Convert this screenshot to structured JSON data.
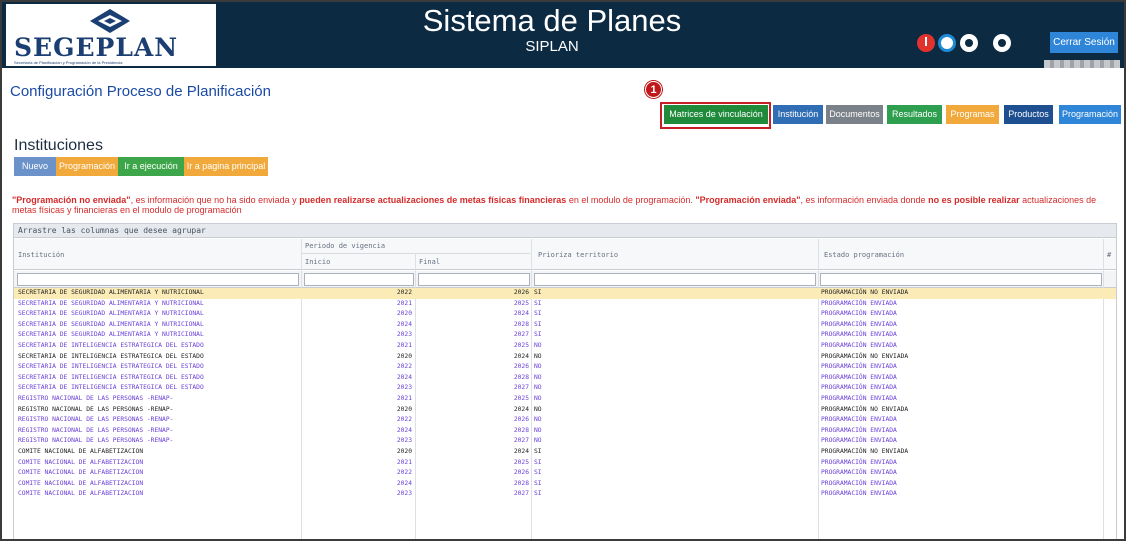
{
  "header": {
    "logo_text": "SEGEPLAN",
    "logo_subtitle": "Secretaría de Planificación y Programación de la Presidencia",
    "app_title": "Sistema de Planes",
    "app_subtitle": "SIPLAN",
    "logout_label": "Cerrar Sesión",
    "icons": [
      "alert-icon",
      "disk-icon",
      "circle-icon",
      "circle-icon"
    ]
  },
  "page": {
    "config_title": "Configuración Proceso de Planificación",
    "step_badge": "1"
  },
  "top_nav": [
    {
      "label": "Matrices de vinculación",
      "color": "#1e8a3a"
    },
    {
      "label": "Institución",
      "color": "#2f6db5"
    },
    {
      "label": "Documentos",
      "color": "#7a8189"
    },
    {
      "label": "Resultados",
      "color": "#2e9e4f"
    },
    {
      "label": "Programas",
      "color": "#f2a93b"
    },
    {
      "label": "Productos",
      "color": "#1d4f91"
    },
    {
      "label": "Programación",
      "color": "#2f86d9"
    }
  ],
  "institutions": {
    "title": "Instituciones",
    "actions": [
      {
        "label": "Nuevo",
        "color": "#6c93c9"
      },
      {
        "label": "Programación",
        "color": "#f2a93b"
      },
      {
        "label": "Ir a ejecución",
        "color": "#3ea64a"
      },
      {
        "label": "Ir a pagina principal",
        "color": "#f2a93b"
      }
    ]
  },
  "notice": {
    "p1_bold": "\"Programación no enviada\"",
    "p2": ", es información que no ha sido enviada y ",
    "p3_bold": "pueden realizarse actualizaciones de metas físicas financieras",
    "p4": " en el modulo de programación. ",
    "p5_bold": "\"Programación enviada\"",
    "p6": ", es información enviada donde ",
    "p7_bold": "no es posible realizar",
    "p8": " actualizaciones de metas físicas y financieras en el modulo de programación"
  },
  "grid": {
    "group_bar": "Arrastre las columnas que desee agrupar",
    "columns": {
      "institucion": "Institución",
      "periodo": "Periodo de vigencia",
      "inicio": "Inicio",
      "final": "Final",
      "prioriza": "Prioriza territorio",
      "estado": "Estado programación",
      "hash": "#"
    },
    "rows": [
      {
        "inst": "SECRETARIA DE SEGURIDAD ALIMENTARIA Y NUTRICIONAL",
        "ini": "2022",
        "fin": "2026",
        "pri": "SI",
        "est": "PROGRAMACIÓN NO ENVIADA",
        "style": "sel"
      },
      {
        "inst": "SECRETARIA DE SEGURIDAD ALIMENTARIA Y NUTRICIONAL",
        "ini": "2021",
        "fin": "2025",
        "pri": "SI",
        "est": "PROGRAMACIÓN ENVIADA",
        "style": ""
      },
      {
        "inst": "SECRETARIA DE SEGURIDAD ALIMENTARIA Y NUTRICIONAL",
        "ini": "2020",
        "fin": "2024",
        "pri": "SI",
        "est": "PROGRAMACIÓN ENVIADA",
        "style": ""
      },
      {
        "inst": "SECRETARIA DE SEGURIDAD ALIMENTARIA Y NUTRICIONAL",
        "ini": "2024",
        "fin": "2028",
        "pri": "SI",
        "est": "PROGRAMACIÓN ENVIADA",
        "style": ""
      },
      {
        "inst": "SECRETARIA DE SEGURIDAD ALIMENTARIA Y NUTRICIONAL",
        "ini": "2023",
        "fin": "2027",
        "pri": "SI",
        "est": "PROGRAMACIÓN ENVIADA",
        "style": ""
      },
      {
        "inst": "SECRETARIA DE INTELIGENCIA ESTRATEGICA DEL ESTADO",
        "ini": "2021",
        "fin": "2025",
        "pri": "NO",
        "est": "PROGRAMACIÓN ENVIADA",
        "style": ""
      },
      {
        "inst": "SECRETARIA DE INTELIGENCIA ESTRATEGICA DEL ESTADO",
        "ini": "2020",
        "fin": "2024",
        "pri": "NO",
        "est": "PROGRAMACIÓN NO ENVIADA",
        "style": "black"
      },
      {
        "inst": "SECRETARIA DE INTELIGENCIA ESTRATEGICA DEL ESTADO",
        "ini": "2022",
        "fin": "2026",
        "pri": "NO",
        "est": "PROGRAMACIÓN ENVIADA",
        "style": ""
      },
      {
        "inst": "SECRETARIA DE INTELIGENCIA ESTRATEGICA DEL ESTADO",
        "ini": "2024",
        "fin": "2028",
        "pri": "NO",
        "est": "PROGRAMACIÓN ENVIADA",
        "style": ""
      },
      {
        "inst": "SECRETARIA DE INTELIGENCIA ESTRATEGICA DEL ESTADO",
        "ini": "2023",
        "fin": "2027",
        "pri": "NO",
        "est": "PROGRAMACIÓN ENVIADA",
        "style": ""
      },
      {
        "inst": "REGISTRO NACIONAL DE LAS PERSONAS -RENAP-",
        "ini": "2021",
        "fin": "2025",
        "pri": "NO",
        "est": "PROGRAMACIÓN ENVIADA",
        "style": ""
      },
      {
        "inst": "REGISTRO NACIONAL DE LAS PERSONAS -RENAP-",
        "ini": "2020",
        "fin": "2024",
        "pri": "NO",
        "est": "PROGRAMACIÓN NO ENVIADA",
        "style": "black"
      },
      {
        "inst": "REGISTRO NACIONAL DE LAS PERSONAS -RENAP-",
        "ini": "2022",
        "fin": "2026",
        "pri": "NO",
        "est": "PROGRAMACIÓN ENVIADA",
        "style": ""
      },
      {
        "inst": "REGISTRO NACIONAL DE LAS PERSONAS -RENAP-",
        "ini": "2024",
        "fin": "2028",
        "pri": "NO",
        "est": "PROGRAMACIÓN ENVIADA",
        "style": ""
      },
      {
        "inst": "REGISTRO NACIONAL DE LAS PERSONAS -RENAP-",
        "ini": "2023",
        "fin": "2027",
        "pri": "NO",
        "est": "PROGRAMACIÓN ENVIADA",
        "style": ""
      },
      {
        "inst": "COMITE NACIONAL DE ALFABETIZACION",
        "ini": "2020",
        "fin": "2024",
        "pri": "SI",
        "est": "PROGRAMACIÓN NO ENVIADA",
        "style": "black"
      },
      {
        "inst": "COMITE NACIONAL DE ALFABETIZACION",
        "ini": "2021",
        "fin": "2025",
        "pri": "SI",
        "est": "PROGRAMACIÓN ENVIADA",
        "style": ""
      },
      {
        "inst": "COMITE NACIONAL DE ALFABETIZACION",
        "ini": "2022",
        "fin": "2026",
        "pri": "SI",
        "est": "PROGRAMACIÓN ENVIADA",
        "style": ""
      },
      {
        "inst": "COMITE NACIONAL DE ALFABETIZACION",
        "ini": "2024",
        "fin": "2028",
        "pri": "SI",
        "est": "PROGRAMACIÓN ENVIADA",
        "style": ""
      },
      {
        "inst": "COMITE NACIONAL DE ALFABETIZACION",
        "ini": "2023",
        "fin": "2027",
        "pri": "SI",
        "est": "PROGRAMACIÓN ENVIADA",
        "style": ""
      }
    ]
  }
}
